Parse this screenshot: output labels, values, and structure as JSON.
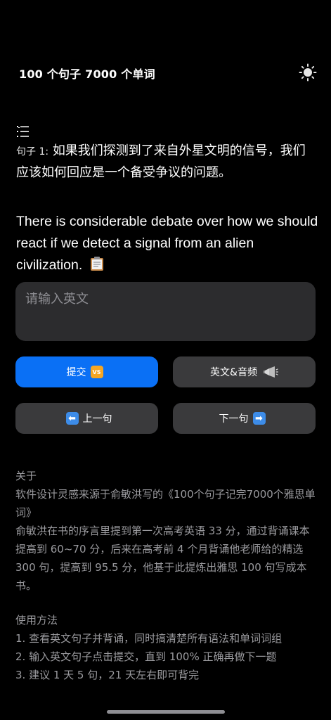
{
  "header": {
    "title": "100 个句子 7000 个单词",
    "theme_icon": "sun-icon"
  },
  "sentence": {
    "list_icon": "list-icon",
    "number_label": "句子 1:",
    "chinese": "如果我们探测到了来自外星文明的信号，我们应该如何回应是一个备受争议的问题。",
    "english": "There is considerable debate over how we should react if we detect a signal from an alien civilization.",
    "copy_icon": "clipboard-icon"
  },
  "input": {
    "placeholder": "请输入英文",
    "value": ""
  },
  "buttons": {
    "submit": "提交",
    "submit_emoji": "VS",
    "audio": "英文&音频",
    "prev": "上一句",
    "prev_emoji": "⬅",
    "next": "下一句",
    "next_emoji": "➡"
  },
  "about": {
    "heading": "关于",
    "line1": "软件设计灵感来源于俞敏洪写的《100个句子记完7000个雅思单词》",
    "line2": "俞敏洪在书的序言里提到第一次高考英语 33 分，通过背诵课本提高到 60~70 分，后来在高考前 4 个月背诵他老师给的精选 300 句，提高到 95.5 分，他基于此提炼出雅思 100 句写成本书。"
  },
  "usage": {
    "heading": "使用方法",
    "items": [
      "1. 查看英文句子并背诵，同时搞清楚所有语法和单词词组",
      "2. 输入英文句子点击提交，直到 100% 正确再做下一题",
      "3. 建议 1 天 5 句，21 天左右即可背完"
    ]
  },
  "colors": {
    "background": "#000000",
    "primary_button": "#0a70f5",
    "secondary_button": "#3a3a3c",
    "input_bg": "#2c2c2e",
    "muted_text": "#9a9a9e"
  }
}
